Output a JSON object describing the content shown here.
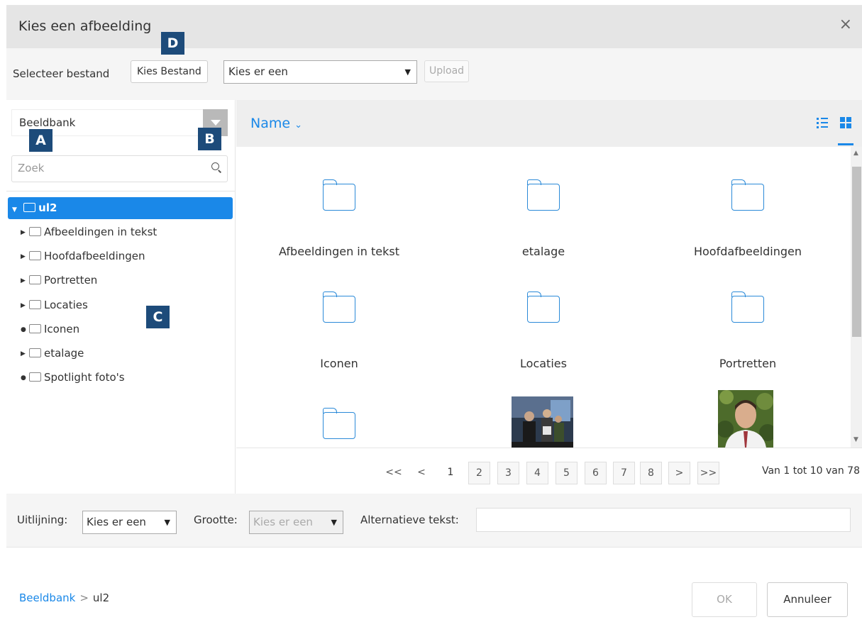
{
  "dialog": {
    "title": "Kies een afbeelding",
    "close": "×"
  },
  "toolbar": {
    "select_label": "Selecteer bestand",
    "choose_button": "Kies Bestand",
    "upload_select_value": "Kies er een",
    "upload_button": "Upload"
  },
  "sidebar": {
    "bank_select": "Beeldbank",
    "search_placeholder": "Zoek",
    "root": "ul2",
    "items": [
      {
        "label": "Afbeeldingen in tekst",
        "marker": "▶"
      },
      {
        "label": "Hoofdafbeeldingen",
        "marker": "▶"
      },
      {
        "label": "Portretten",
        "marker": "▶"
      },
      {
        "label": "Locaties",
        "marker": "▶"
      },
      {
        "label": "Iconen",
        "marker": "●"
      },
      {
        "label": "etalage",
        "marker": "▶"
      },
      {
        "label": "Spotlight foto's",
        "marker": "●"
      }
    ]
  },
  "main": {
    "sort_label": "Name",
    "sort_chevron": "⌄",
    "tiles": [
      {
        "label": "Afbeeldingen in tekst"
      },
      {
        "label": "etalage"
      },
      {
        "label": "Hoofdafbeeldingen"
      },
      {
        "label": "Iconen"
      },
      {
        "label": "Locaties"
      },
      {
        "label": "Portretten"
      }
    ]
  },
  "pager": {
    "first": "<<",
    "prev": "<",
    "pages": [
      "1",
      "2",
      "3",
      "4",
      "5",
      "6",
      "7",
      "8"
    ],
    "next": ">",
    "last": ">>",
    "count_text": "Van 1 tot 10 van 78"
  },
  "options": {
    "align_label": "Uitlijning:",
    "align_value": "Kies er een",
    "size_label": "Grootte:",
    "size_value": "Kies er een",
    "alt_label": "Alternatieve tekst:"
  },
  "footer": {
    "crumb_link": "Beeldbank",
    "crumb_sep": ">",
    "crumb_current": "ul2",
    "ok": "OK",
    "cancel": "Annuleer"
  },
  "callouts": {
    "a": "A",
    "b": "B",
    "c": "C",
    "d": "D"
  },
  "colors": {
    "accent": "#1a88e8",
    "callout": "#1d4b7a"
  }
}
